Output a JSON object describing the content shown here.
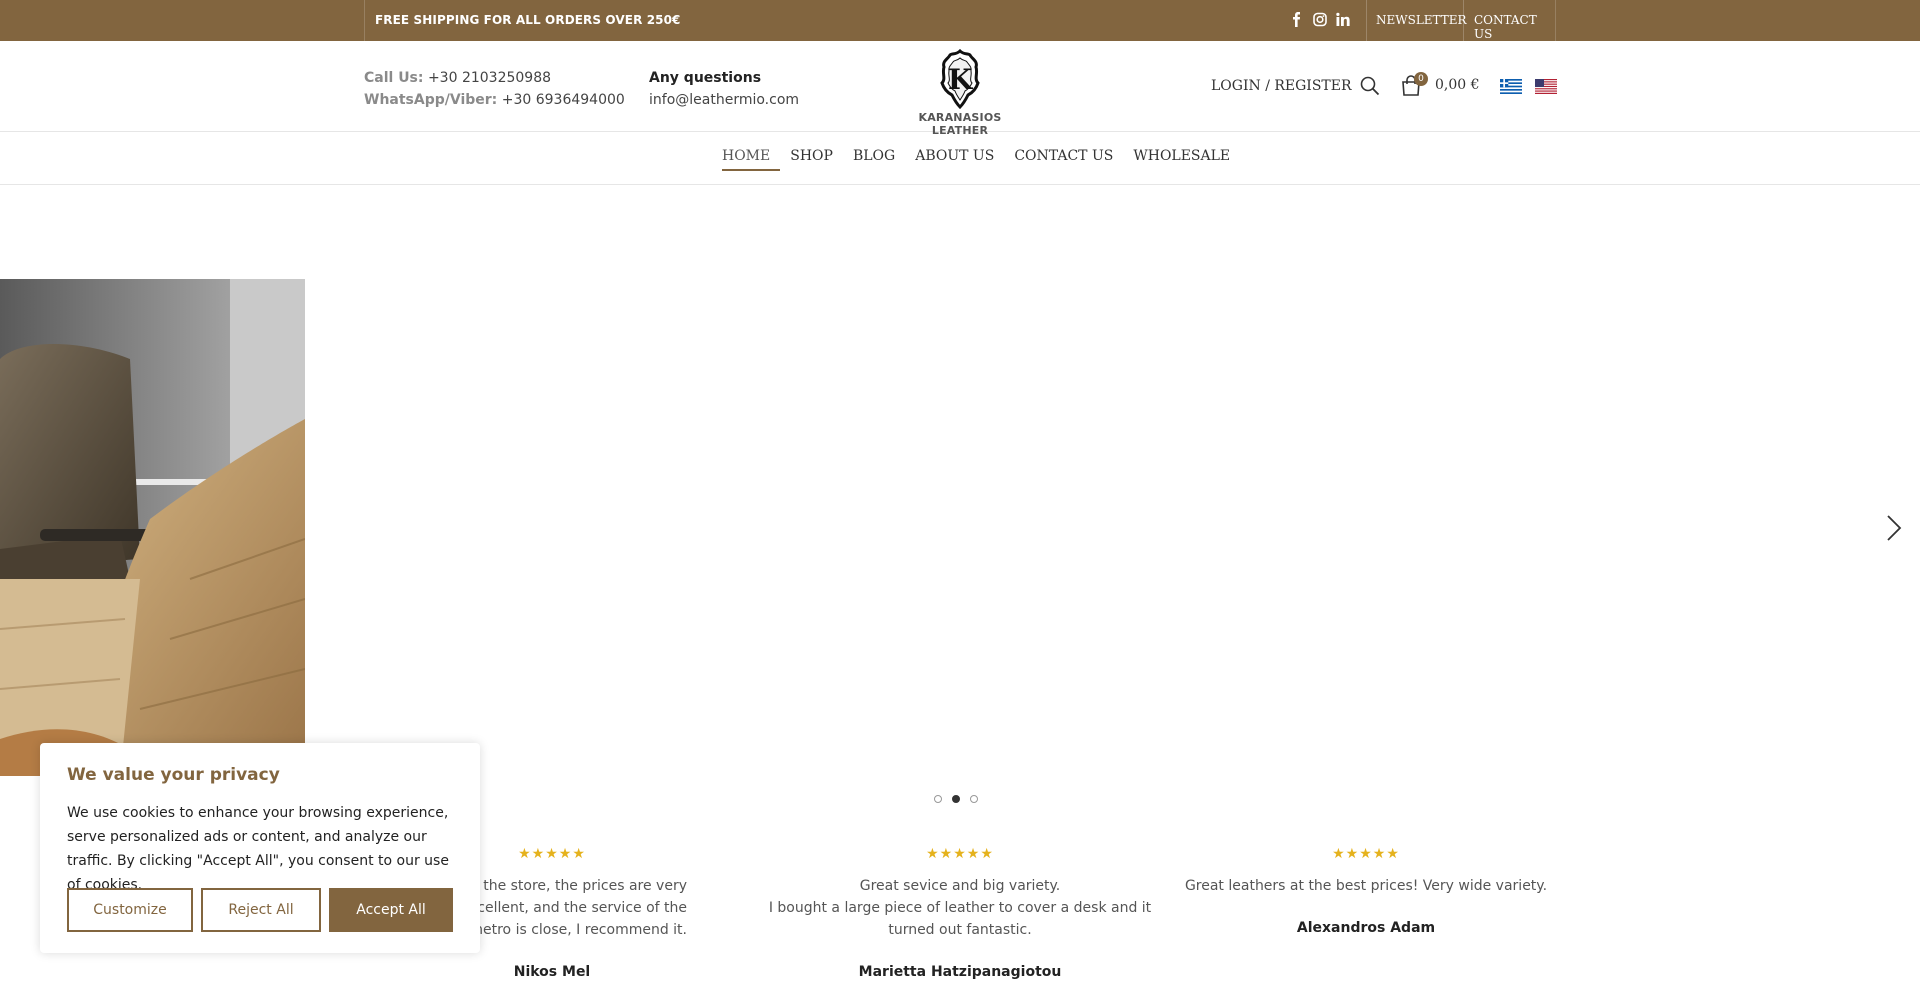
{
  "topbar": {
    "shipping": "FREE SHIPPING FOR ALL ORDERS OVER 250€",
    "socials": [
      "facebook-icon",
      "instagram-icon",
      "linkedin-icon"
    ],
    "newsletter": "NEWSLETTER",
    "contact": "CONTACT US"
  },
  "header": {
    "call_label": "Call Us:",
    "call_number": "+30 2103250988",
    "whatsapp_label": "WhatsApp/Viber:",
    "whatsapp_number": "+30 6936494000",
    "questions_label": "Any questions",
    "email": "info@leathermio.com",
    "logo_letter": "K",
    "logo_text": "KARANASIOS LEATHER",
    "login": "LOGIN / REGISTER",
    "cart_count": "0",
    "cart_total": "0,00 €"
  },
  "nav": {
    "items": [
      "HOME",
      "SHOP",
      "BLOG",
      "ABOUT US",
      "CONTACT US",
      "WHOLESALE"
    ]
  },
  "testimonials": [
    {
      "stars": "★★★★★",
      "line1": "me I shop at the store, the prices are very",
      "line2": "ers are excellent, and the service of the",
      "line3": "e, and the metro is close, I recommend it.",
      "name": "Nikos Mel"
    },
    {
      "stars": "★★★★★",
      "line1": "Great sevice and big variety.",
      "line2": "I bought a large piece of leather to cover a desk and it",
      "line3": "turned out fantastic.",
      "name": "Marietta Hatzipanagiotou"
    },
    {
      "stars": "★★★★★",
      "line1": "Great leathers at the best prices! Very wide variety.",
      "name": "Alexandros Adam"
    }
  ],
  "cookie": {
    "title": "We value your privacy",
    "text": "We use cookies to enhance your browsing experience, serve personalized ads or content, and analyze our traffic. By clicking \"Accept All\", you consent to our use of cookies.",
    "customize": "Customize",
    "reject": "Reject All",
    "accept": "Accept All"
  },
  "colors": {
    "brand": "#82653f",
    "stars": "#e5b21d"
  }
}
